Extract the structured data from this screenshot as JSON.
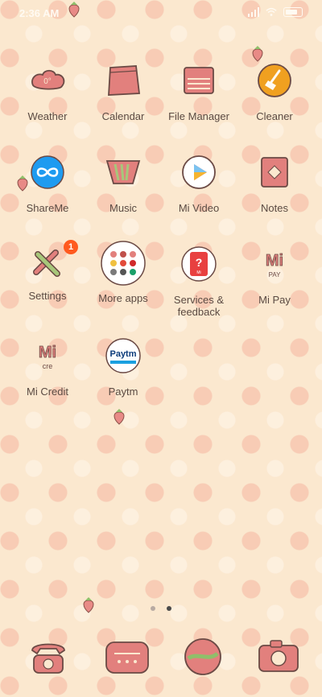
{
  "status": {
    "time": "2:36 AM",
    "battery": "100"
  },
  "apps": [
    {
      "label": "Weather"
    },
    {
      "label": "Calendar"
    },
    {
      "label": "File Manager"
    },
    {
      "label": "Cleaner"
    },
    {
      "label": "ShareMe"
    },
    {
      "label": "Music"
    },
    {
      "label": "Mi Video"
    },
    {
      "label": "Notes"
    },
    {
      "label": "Settings",
      "badge": "1"
    },
    {
      "label": "More apps"
    },
    {
      "label": "Services & feedback"
    },
    {
      "label": "Mi Pay"
    },
    {
      "label": "Mi Credit"
    },
    {
      "label": "Paytm"
    }
  ],
  "icon_text": {
    "weather": "0°",
    "mipay_top": "Mi",
    "mipay_bottom": "PAY",
    "micredit_top": "Mi",
    "micredit_bottom": "cre",
    "paytm": "Paytm",
    "services": "?",
    "services_small": "Mi"
  },
  "page_indicator": {
    "pages": 2,
    "active": 2
  },
  "colors": {
    "background": "#fbe8cf",
    "icon_pink": "#e2807d",
    "icon_outline": "#6b4a45",
    "text": "#5a4a42",
    "badge": "#ff5a1f",
    "shareme_blue": "#1e9bf0",
    "cleaner_orange": "#f0a020"
  }
}
